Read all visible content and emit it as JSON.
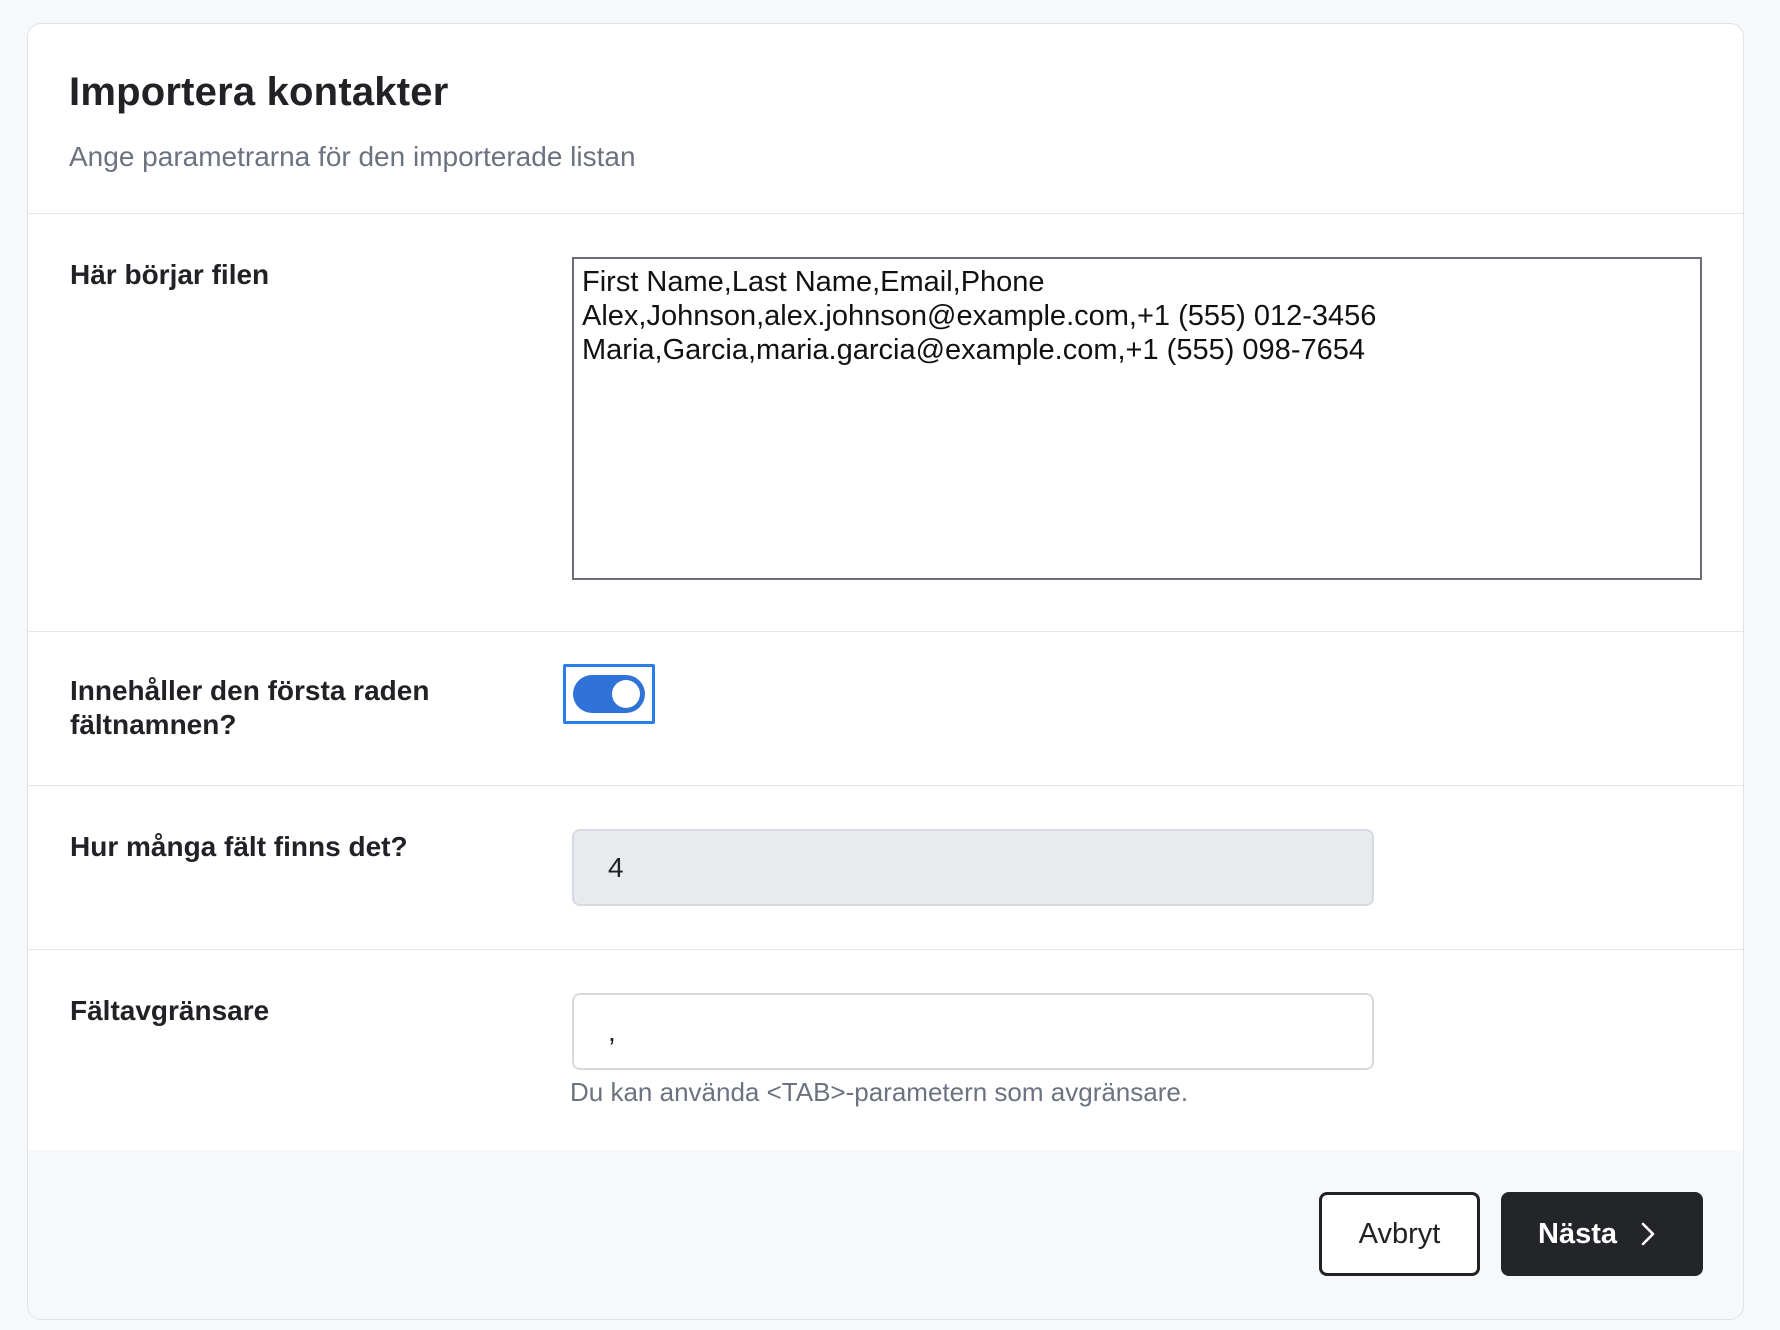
{
  "header": {
    "title": "Importera kontakter",
    "subtitle": "Ange parametrarna för den importerade listan"
  },
  "file_start": {
    "label": "Här börjar filen",
    "content": "First Name,Last Name,Email,Phone\nAlex,Johnson,alex.johnson@example.com,+1 (555) 012-3456\nMaria,Garcia,maria.garcia@example.com,+1 (555) 098-7654"
  },
  "header_row": {
    "label": "Innehåller den första raden fältnamnen?",
    "checked": true
  },
  "field_count": {
    "label": "Hur många fält finns det?",
    "value": "4"
  },
  "delimiter": {
    "label": "Fältavgränsare",
    "value": ",",
    "hint": "Du kan använda <TAB>-parametern som avgränsare."
  },
  "footer": {
    "cancel_label": "Avbryt",
    "next_label": "Nästa"
  },
  "colors": {
    "toggle_on": "#2f73d9",
    "focus_ring": "#2b7de9",
    "primary_button": "#232528"
  },
  "icons": {
    "next": "chevron-right-icon"
  }
}
